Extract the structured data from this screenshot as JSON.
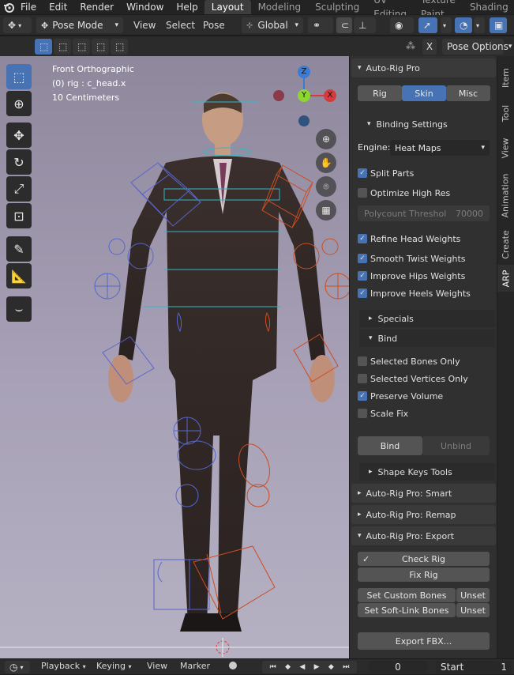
{
  "menu": {
    "items": [
      "File",
      "Edit",
      "Render",
      "Window",
      "Help"
    ],
    "workspaces": [
      "Layout",
      "Modeling",
      "Sculpting",
      "UV Editing",
      "Texture Paint",
      "Shading"
    ]
  },
  "header": {
    "mode": "Pose Mode",
    "view": "View",
    "select": "Select",
    "pose": "Pose",
    "orientation": "Global",
    "pose_options": "Pose Options",
    "close": "X"
  },
  "viewport": {
    "title": "Front Orthographic",
    "object": "(0) rig : c_head.x",
    "scale": "10 Centimeters",
    "gizmo": {
      "z": "Z",
      "y": "Y",
      "x": "X"
    }
  },
  "panel": {
    "autorig_title": "Auto-Rig Pro",
    "tabs": [
      "Rig",
      "Skin",
      "Misc"
    ],
    "binding_settings": "Binding Settings",
    "engine_label": "Engine:",
    "engine_value": "Heat Maps",
    "split_parts": "Split Parts",
    "optimize": "Optimize High Res",
    "polycount_label": "Polycount Threshol",
    "polycount_value": "70000",
    "refine": "Refine Head Weights",
    "smooth": "Smooth Twist Weights",
    "hips": "Improve Hips Weights",
    "heels": "Improve Heels Weights",
    "specials": "Specials",
    "bind_section": "Bind",
    "sel_bones": "Selected Bones Only",
    "sel_verts": "Selected Vertices Only",
    "preserve": "Preserve Volume",
    "scale_fix": "Scale Fix",
    "bind_btn": "Bind",
    "unbind_btn": "Unbind",
    "shape_keys": "Shape Keys Tools",
    "smart": "Auto-Rig Pro: Smart",
    "remap": "Auto-Rig Pro: Remap",
    "export": "Auto-Rig Pro: Export",
    "check_rig": "Check Rig",
    "fix_rig": "Fix Rig",
    "set_custom": "Set Custom Bones",
    "unset1": "Unset",
    "set_soft": "Set Soft-Link Bones",
    "unset2": "Unset",
    "export_fbx": "Export FBX..."
  },
  "side_tabs": [
    "Item",
    "Tool",
    "View",
    "Animation",
    "Create",
    "ARP"
  ],
  "timeline": {
    "playback": "Playback",
    "keying": "Keying",
    "view": "View",
    "marker": "Marker",
    "frame": "0",
    "start": "Start",
    "start_val": "1"
  },
  "colors": {
    "accent": "#4772b3",
    "left_bones": "#5566cc",
    "right_bones": "#cc4d1f",
    "spine": "#2fb8c8"
  }
}
